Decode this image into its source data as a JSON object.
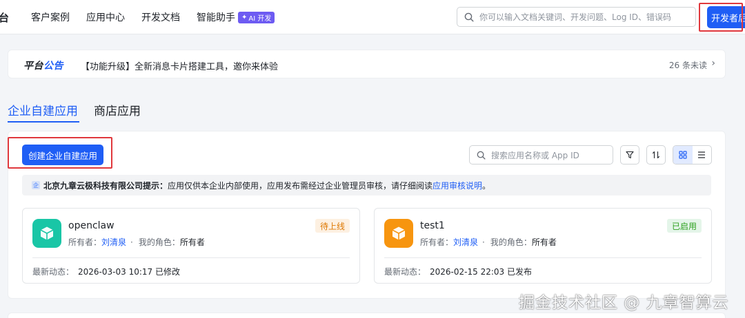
{
  "topbar": {
    "brand_fragment": "台",
    "nav": [
      "客户案例",
      "应用中心",
      "开发文档",
      "智能助手"
    ],
    "ai_badge": "AI 开发",
    "search_placeholder": "你可以输入文档关键词、开发问题、Log ID、错误码",
    "developer_button": "开发者后台"
  },
  "announcement": {
    "brand_part1": "平台",
    "brand_part2": "公告",
    "text": "【功能升级】全新消息卡片搭建工具，邀你来体验",
    "unread": "26 条未读"
  },
  "tabs": [
    {
      "label": "企业自建应用",
      "active": true
    },
    {
      "label": "商店应用",
      "active": false
    }
  ],
  "toolbar": {
    "create_button": "创建企业自建应用",
    "search_placeholder": "搜索应用名称或 App ID"
  },
  "notice": {
    "company": "北京九章云极科技有限公司提示：",
    "text": "应用仅供本企业内部使用，应用发布需经过企业管理员审核，请仔细阅读",
    "link": "应用审核说明",
    "end": "。"
  },
  "apps": [
    {
      "name": "openclaw",
      "status": "待上线",
      "owner_label": "所有者：",
      "owner": "刘清泉",
      "role_label": "我的角色：",
      "role": "所有者",
      "activity_label": "最新动态：",
      "activity": "2026-03-03 10:17 已修改",
      "icon_color": "#19c6a6",
      "status_color": "#de7802"
    },
    {
      "name": "test1",
      "status": "已启用",
      "owner_label": "所有者：",
      "owner": "刘清泉",
      "role_label": "我的角色：",
      "role": "所有者",
      "activity_label": "最新动态：",
      "activity": "2026-02-15 22:03 已发布",
      "icon_color": "#f7950f",
      "status_color": "#2ea121"
    }
  ],
  "watermark": "掘金技术社区 @ 九章智算云",
  "colors": {
    "primary": "#1f5ef5",
    "highlight": "#e0383d",
    "ai_badge": "#6d5bf2"
  }
}
